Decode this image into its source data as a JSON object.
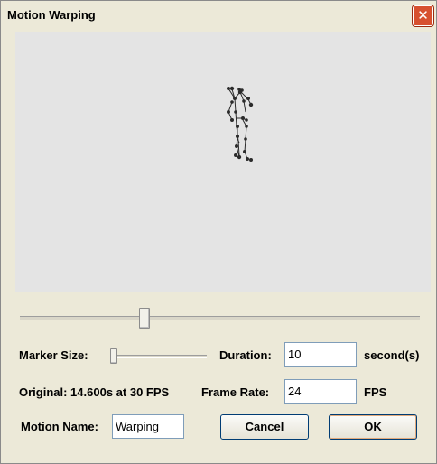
{
  "window": {
    "title": "Motion Warping",
    "close_glyph": "✕"
  },
  "controls": {
    "marker_size_label": "Marker Size:",
    "duration_label": "Duration:",
    "duration_value": "10",
    "duration_unit": "second(s)",
    "original_info": "Original: 14.600s at 30 FPS",
    "frame_rate_label": "Frame Rate:",
    "frame_rate_value": "24",
    "frame_rate_unit": "FPS",
    "motion_name_label": "Motion Name:",
    "motion_name_value": "Warping"
  },
  "buttons": {
    "cancel": "Cancel",
    "ok": "OK"
  },
  "icons": {
    "close": "close-icon"
  },
  "colors": {
    "viewport_bg": "#e4e4e4",
    "figure": "#2b2b2b",
    "close_bg": "#d7502f"
  }
}
